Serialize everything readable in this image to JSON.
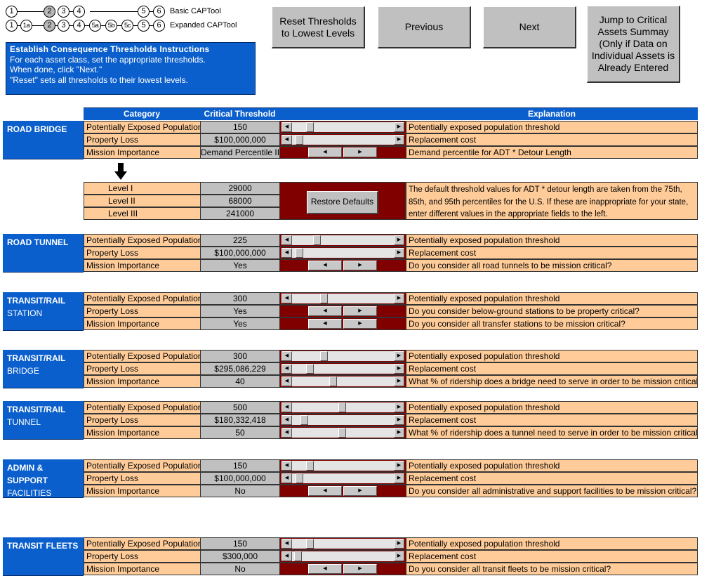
{
  "nav": {
    "basic_label": "Basic CAPTool",
    "expanded_label": "Expanded CAPTool",
    "basic_steps": [
      "1",
      "2",
      "3",
      "4",
      "5",
      "6"
    ],
    "expanded_steps": [
      "1",
      "1a",
      "2",
      "3",
      "4",
      "5a",
      "5b",
      "5c",
      "5",
      "6"
    ],
    "active_step": "2"
  },
  "instructions": {
    "title": "Establish Consequence Thresholds Instructions",
    "lines": [
      "For each asset class, set the appropriate thresholds.",
      "When done, click \"Next.\"",
      "\"Reset\" sets all thresholds to their lowest levels."
    ]
  },
  "buttons": {
    "reset": "Reset Thresholds\nto Lowest Levels",
    "previous": "Previous",
    "next": "Next",
    "jump": "Jump to Critical\nAssets Summay\n(Only if Data on\nIndividual Assets is\nAlready Entered",
    "restore_defaults": "Restore Defaults"
  },
  "table_header": {
    "category": "Category",
    "threshold": "Critical Threshold",
    "control": "",
    "explanation": "Explanation"
  },
  "demand_levels": {
    "rows": [
      {
        "label": "Level I",
        "value": "29000"
      },
      {
        "label": "Level II",
        "value": "68000"
      },
      {
        "label": "Level III",
        "value": "241000"
      }
    ],
    "note": "The default threshold values for ADT * detour length are taken from the 75th, 85th, and 95th percentiles for the U.S.  If these are inappropriate for your state, enter different values in the appropriate fields to the left."
  },
  "assets": [
    {
      "name_line1": "ROAD BRIDGE",
      "name_line2": "",
      "rows": [
        {
          "category": "Potentially Exposed Population",
          "value": "150",
          "control": "scrollbar",
          "position": 0.15,
          "explanation": "Potentially exposed population threshold"
        },
        {
          "category": "Property Loss",
          "value": "$100,000,000",
          "control": "scrollbar",
          "position": 0.04,
          "explanation": "Replacement cost"
        },
        {
          "category": "Mission Importance",
          "value": "Demand Percentile II",
          "control": "spinner",
          "explanation": "Demand percentile for ADT * Detour Length"
        }
      ]
    },
    {
      "name_line1": "ROAD TUNNEL",
      "name_line2": "",
      "rows": [
        {
          "category": "Potentially Exposed Population",
          "value": "225",
          "control": "scrollbar",
          "position": 0.23,
          "explanation": "Potentially exposed population threshold"
        },
        {
          "category": "Property Loss",
          "value": "$100,000,000",
          "control": "scrollbar",
          "position": 0.04,
          "explanation": "Replacement cost"
        },
        {
          "category": "Mission Importance",
          "value": "Yes",
          "control": "spinner",
          "explanation": "Do you consider all road tunnels to be mission critical?"
        }
      ]
    },
    {
      "name_line1": "TRANSIT/RAIL",
      "name_line2": "STATION",
      "rows": [
        {
          "category": "Potentially Exposed Population",
          "value": "300",
          "control": "scrollbar",
          "position": 0.3,
          "explanation": "Potentially exposed population threshold"
        },
        {
          "category": "Property Loss",
          "value": "Yes",
          "control": "spinner",
          "explanation": "Do you consider below-ground stations to be property critical?"
        },
        {
          "category": "Mission Importance",
          "value": "Yes",
          "control": "spinner",
          "explanation": "Do you consider all transfer stations to be mission critical?"
        }
      ]
    },
    {
      "name_line1": "TRANSIT/RAIL",
      "name_line2": "BRIDGE",
      "rows": [
        {
          "category": "Potentially Exposed Population",
          "value": "300",
          "control": "scrollbar",
          "position": 0.3,
          "explanation": "Potentially exposed population threshold"
        },
        {
          "category": "Property Loss",
          "value": "$295,086,229",
          "control": "scrollbar",
          "position": 0.15,
          "explanation": "Replacement cost"
        },
        {
          "category": "Mission Importance",
          "value": "40",
          "control": "scrollbar",
          "position": 0.4,
          "explanation": "What % of ridership does a bridge need to serve in order to be mission critical?"
        }
      ]
    },
    {
      "name_line1": "TRANSIT/RAIL",
      "name_line2": "TUNNEL",
      "rows": [
        {
          "category": "Potentially Exposed Population",
          "value": "500",
          "control": "scrollbar",
          "position": 0.5,
          "explanation": "Potentially exposed population threshold"
        },
        {
          "category": "Property Loss",
          "value": "$180,332,418",
          "control": "scrollbar",
          "position": 0.09,
          "explanation": "Replacement cost"
        },
        {
          "category": "Mission Importance",
          "value": "50",
          "control": "scrollbar",
          "position": 0.5,
          "explanation": "What % of ridership does a tunnel need to serve in order to be mission critical?"
        }
      ]
    },
    {
      "name_line1": "ADMIN & SUPPORT",
      "name_line2": "FACILITIES",
      "rows": [
        {
          "category": "Potentially Exposed Population",
          "value": "150",
          "control": "scrollbar",
          "position": 0.15,
          "explanation": "Potentially exposed population threshold"
        },
        {
          "category": "Property Loss",
          "value": "$100,000,000",
          "control": "scrollbar",
          "position": 0.04,
          "explanation": "Replacement cost"
        },
        {
          "category": "Mission Importance",
          "value": "No",
          "control": "spinner",
          "explanation": "Do you consider all administrative and support facilities to be mission critical?"
        }
      ]
    },
    {
      "name_line1": "TRANSIT FLEETS",
      "name_line2": "",
      "rows": [
        {
          "category": "Potentially Exposed Population",
          "value": "150",
          "control": "scrollbar",
          "position": 0.15,
          "explanation": "Potentially exposed population threshold"
        },
        {
          "category": "Property Loss",
          "value": "$300,000",
          "control": "scrollbar",
          "position": 0.02,
          "explanation": "Replacement cost"
        },
        {
          "category": "Mission Importance",
          "value": "No",
          "control": "spinner",
          "explanation": "Do you consider all transit fleets to be mission critical?"
        }
      ]
    }
  ]
}
